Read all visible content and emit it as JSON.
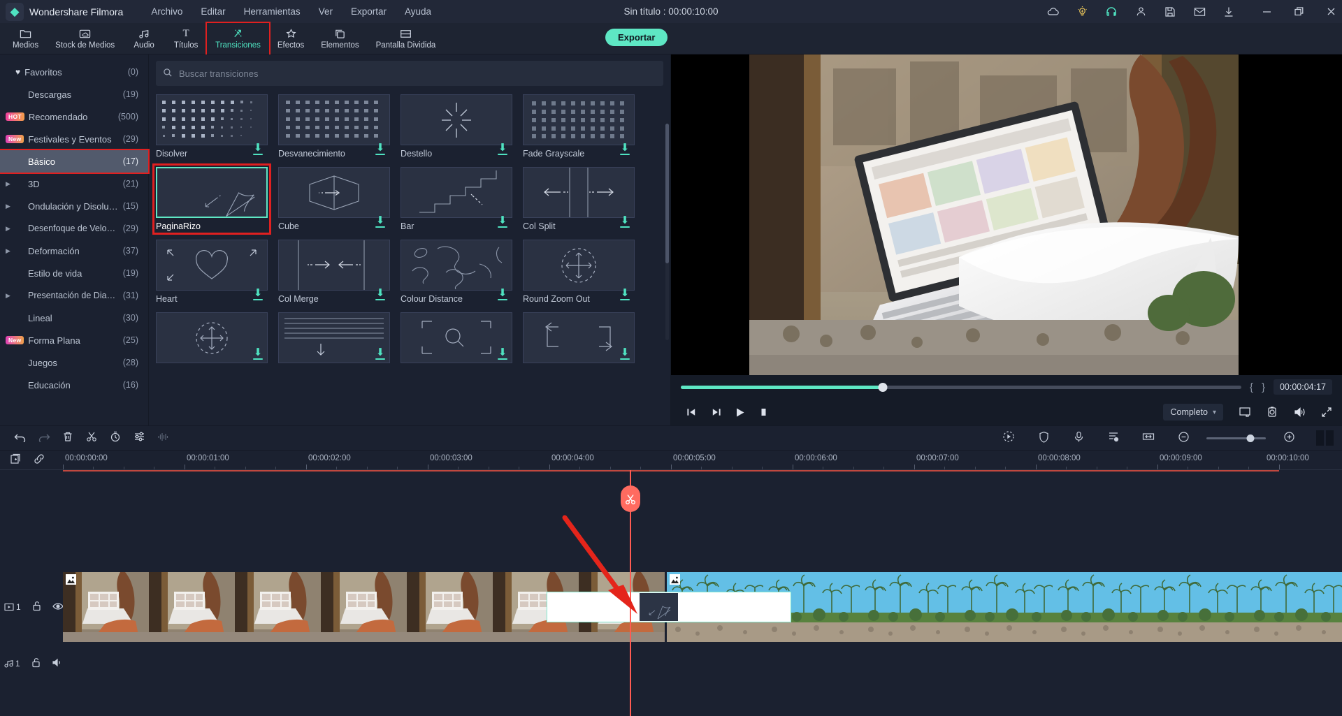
{
  "titlebar": {
    "brand": "Wondershare Filmora",
    "logo_icon": "filmora-logo-icon",
    "menu": [
      "Archivo",
      "Editar",
      "Herramientas",
      "Ver",
      "Exportar",
      "Ayuda"
    ],
    "document_title": "Sin título : 00:00:10:00",
    "right_icons": [
      "cloud-icon",
      "lightbulb-icon",
      "headset-icon",
      "account-icon",
      "save-icon",
      "mail-icon",
      "download-icon"
    ],
    "window_buttons": [
      "minimize-icon",
      "restore-icon",
      "close-icon"
    ]
  },
  "toolbar": {
    "items": [
      {
        "label": "Medios",
        "icon": "folder-icon"
      },
      {
        "label": "Stock de Medios",
        "icon": "stock-cloud-icon"
      },
      {
        "label": "Audio",
        "icon": "music-note-icon"
      },
      {
        "label": "Títulos",
        "icon": "text-t-icon"
      },
      {
        "label": "Transiciones",
        "icon": "transitions-icon"
      },
      {
        "label": "Efectos",
        "icon": "effects-star-icon"
      },
      {
        "label": "Elementos",
        "icon": "elements-icon"
      },
      {
        "label": "Pantalla Dividida",
        "icon": "split-screen-icon"
      }
    ],
    "active_index": 4,
    "export_label": "Exportar"
  },
  "sidebar": {
    "items": [
      {
        "label": "Favoritos",
        "count": "(0)",
        "icon": "heart-icon",
        "badge": "",
        "expandable": false
      },
      {
        "label": "Descargas",
        "count": "(19)",
        "icon": "",
        "badge": "",
        "expandable": false
      },
      {
        "label": "Recomendado",
        "count": "(500)",
        "icon": "",
        "badge": "HOT",
        "expandable": false
      },
      {
        "label": "Festivales y Eventos",
        "count": "(29)",
        "icon": "",
        "badge": "New",
        "expandable": false
      },
      {
        "label": "Básico",
        "count": "(17)",
        "icon": "",
        "badge": "",
        "expandable": false
      },
      {
        "label": "3D",
        "count": "(21)",
        "icon": "",
        "badge": "",
        "expandable": true
      },
      {
        "label": "Ondulación y Disolución",
        "count": "(15)",
        "icon": "",
        "badge": "",
        "expandable": true
      },
      {
        "label": "Desenfoque de Velocidad",
        "count": "(29)",
        "icon": "",
        "badge": "",
        "expandable": true
      },
      {
        "label": "Deformación",
        "count": "(37)",
        "icon": "",
        "badge": "",
        "expandable": true
      },
      {
        "label": "Estilo de vida",
        "count": "(19)",
        "icon": "",
        "badge": "",
        "expandable": false
      },
      {
        "label": "Presentación de Diaposit...",
        "count": "(31)",
        "icon": "",
        "badge": "",
        "expandable": true
      },
      {
        "label": "Lineal",
        "count": "(30)",
        "icon": "",
        "badge": "",
        "expandable": false
      },
      {
        "label": "Forma Plana",
        "count": "(25)",
        "icon": "",
        "badge": "New",
        "expandable": false
      },
      {
        "label": "Juegos",
        "count": "(28)",
        "icon": "",
        "badge": "",
        "expandable": false
      },
      {
        "label": "Educación",
        "count": "(16)",
        "icon": "",
        "badge": "",
        "expandable": false
      }
    ],
    "selected_index": 4
  },
  "browser": {
    "search_placeholder": "Buscar transiciones",
    "search_value": "",
    "search_icon": "search-icon",
    "grid_view_icon": "grid-view-icon",
    "transitions": [
      {
        "name": "Disolver",
        "icon": "dots-dissolve-icon",
        "download": true,
        "selected": false
      },
      {
        "name": "Desvanecimiento",
        "icon": "dots-fade-icon",
        "download": true,
        "selected": false
      },
      {
        "name": "Destello",
        "icon": "flash-burst-icon",
        "download": true,
        "selected": false
      },
      {
        "name": "Fade Grayscale",
        "icon": "dots-grayscale-icon",
        "download": true,
        "selected": false
      },
      {
        "name": "PaginaRizo",
        "icon": "page-curl-icon",
        "download": false,
        "selected": true
      },
      {
        "name": "Cube",
        "icon": "cube-icon",
        "download": true,
        "selected": false
      },
      {
        "name": "Bar",
        "icon": "stairs-bar-icon",
        "download": true,
        "selected": false
      },
      {
        "name": "Col Split",
        "icon": "col-split-icon",
        "download": true,
        "selected": false
      },
      {
        "name": "Heart",
        "icon": "heart-shape-icon",
        "download": true,
        "selected": false
      },
      {
        "name": "Col Merge",
        "icon": "col-merge-icon",
        "download": true,
        "selected": false
      },
      {
        "name": "Colour Distance",
        "icon": "colour-distance-icon",
        "download": true,
        "selected": false
      },
      {
        "name": "Round Zoom Out",
        "icon": "round-zoom-out-icon",
        "download": true,
        "selected": false
      },
      {
        "name": "",
        "icon": "round-zoom-in-icon",
        "download": true,
        "selected": false
      },
      {
        "name": "",
        "icon": "lines-down-icon",
        "download": true,
        "selected": false
      },
      {
        "name": "",
        "icon": "zoom-box-icon",
        "download": true,
        "selected": false
      },
      {
        "name": "",
        "icon": "swap-arrows-icon",
        "download": true,
        "selected": false
      }
    ]
  },
  "preview": {
    "timecode": "00:00:04:17",
    "mark_in_icon": "mark-in-brace",
    "mark_out_icon": "mark-out-brace",
    "progress_percent": 36,
    "buttons": [
      {
        "icon": "prev-frame-icon",
        "name": "previous-frame-button"
      },
      {
        "icon": "next-frame-icon",
        "name": "next-frame-button"
      },
      {
        "icon": "play-icon",
        "name": "play-button"
      },
      {
        "icon": "stop-icon",
        "name": "stop-button"
      }
    ],
    "quality_label": "Completo",
    "quality_caret": "▾",
    "right_icons": [
      "screen-cast-icon",
      "snapshot-camera-icon",
      "volume-icon",
      "fullscreen-icon"
    ]
  },
  "timeline": {
    "toolbar_left_icons": [
      "undo-icon",
      "redo-icon",
      "delete-icon",
      "split-scissors-icon",
      "speed-timer-icon",
      "adjust-sliders-icon",
      "audio-wave-icon"
    ],
    "toolbar_right_icons": [
      "motion-tracking-icon",
      "mask-shield-icon",
      "voiceover-mic-icon",
      "marker-list-icon",
      "fit-timeline-icon",
      "zoom-out-icon",
      "zoom-in-icon"
    ],
    "zoom_value": 74,
    "ruler_icons": [
      "add-track-icon",
      "link-icon"
    ],
    "ruler_labels": [
      "00:00:00:00",
      "00:00:01:00",
      "00:00:02:00",
      "00:00:03:00",
      "00:00:04:00",
      "00:00:05:00",
      "00:00:06:00",
      "00:00:07:00",
      "00:00:08:00",
      "00:00:09:00",
      "00:00:10:00"
    ],
    "playhead_position": "00:00:04:00",
    "playhead_icon": "scissors-icon",
    "tracks": [
      {
        "type": "video",
        "number": "1",
        "icon": "video-track-icon",
        "lock_icon": "unlock-icon",
        "eye_icon": "eye-icon"
      },
      {
        "type": "audio",
        "number": "1",
        "icon": "audio-track-icon",
        "lock_icon": "unlock-icon",
        "mute_icon": "speaker-icon"
      }
    ],
    "drop_overlay_visible": true,
    "annotation_arrow": "red-arrow-pointing-to-transition"
  },
  "colors": {
    "accent": "#5ee7c4",
    "annotation_red": "#e02020",
    "playhead_red": "#ff5b52",
    "panel_bg": "#1b2130",
    "titlebar_bg": "#222838",
    "selection_gray": "#525a6c"
  }
}
